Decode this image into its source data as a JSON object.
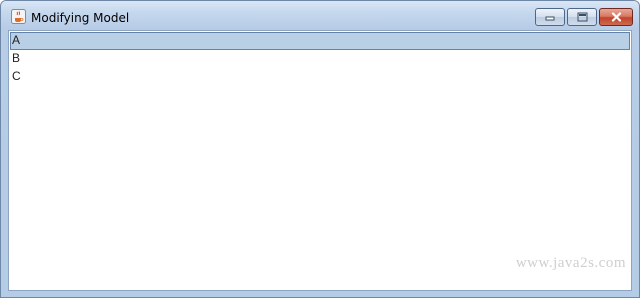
{
  "window": {
    "title": "Modifying Model",
    "controls": {
      "minimize": "minimize-icon",
      "maximize": "maximize-icon",
      "close": "close-icon"
    }
  },
  "list": {
    "items": [
      {
        "label": "A",
        "selected": true
      },
      {
        "label": "B",
        "selected": false
      },
      {
        "label": "C",
        "selected": false
      }
    ],
    "selection_color": "#b8cfe5"
  },
  "watermark": "www.java2s.com"
}
